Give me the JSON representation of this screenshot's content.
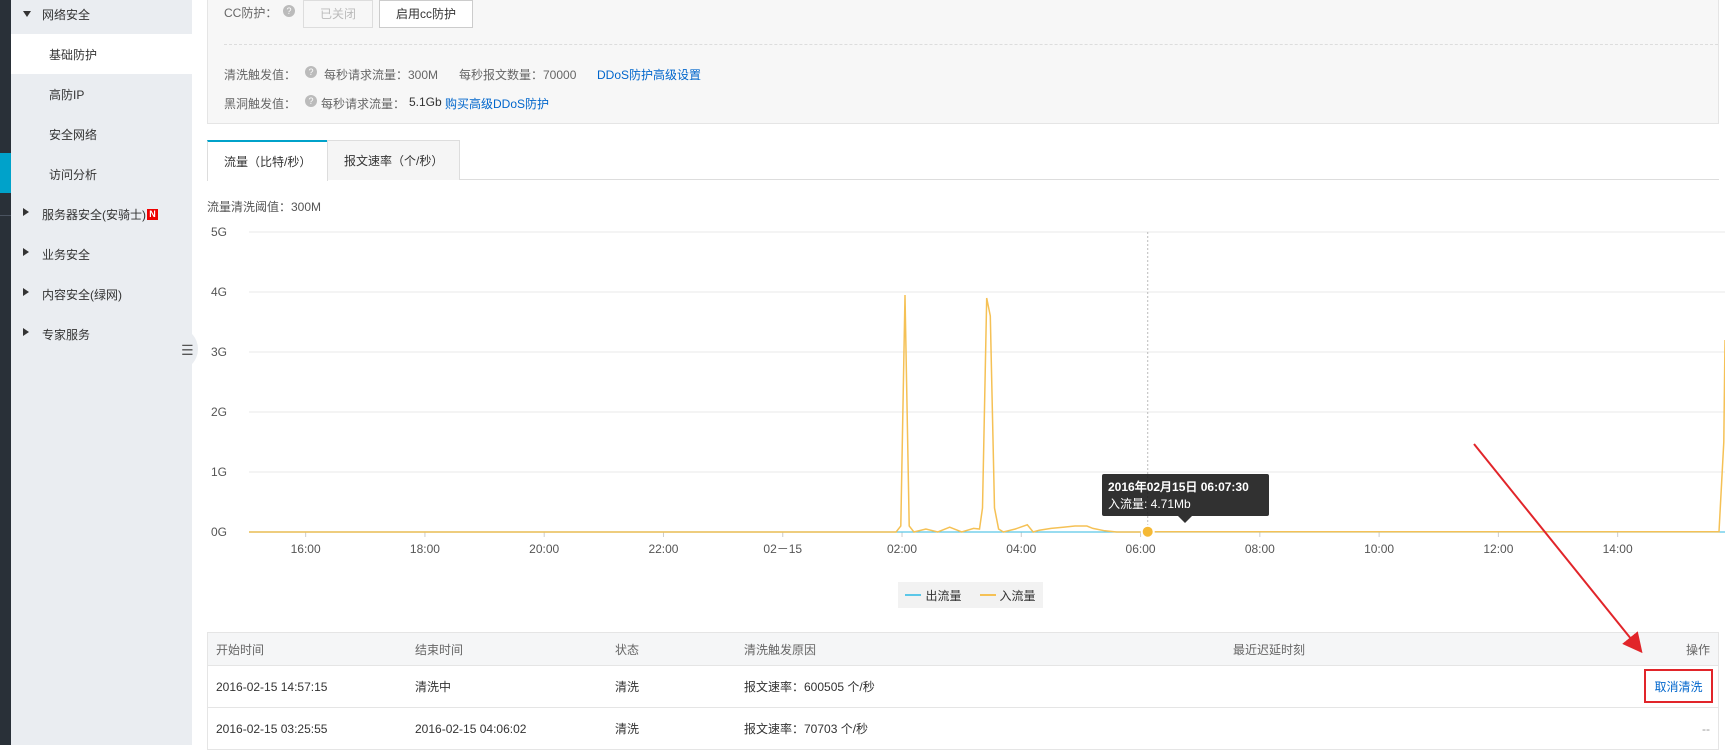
{
  "sidebar": {
    "groups": [
      {
        "label": "网络安全",
        "expanded": true
      },
      {
        "label": "服务器安全(安骑士)",
        "badge": "N"
      },
      {
        "label": "业务安全"
      },
      {
        "label": "内容安全(绿网)"
      },
      {
        "label": "专家服务"
      }
    ],
    "items": [
      {
        "label": "基础防护",
        "active": true
      },
      {
        "label": "高防IP"
      },
      {
        "label": "安全网络"
      },
      {
        "label": "访问分析"
      }
    ],
    "collapse_icon": "list-icon"
  },
  "settings": {
    "cc_label": "CC防护：",
    "cc_off_button": "已关闭",
    "cc_enable_button": "启用cc防护",
    "clean_label": "清洗触发值：",
    "clean_req_label": "每秒请求流量：300M",
    "clean_pkt_label": "每秒报文数量：70000",
    "clean_link": "DDoS防护高级设置",
    "black_label": "黑洞触发值：",
    "black_req_label": "每秒请求流量：",
    "black_req_value": "5.1Gb",
    "black_link": "购买高级DDoS防护"
  },
  "tabs": [
    {
      "label": "流量（比特/秒）",
      "active": true
    },
    {
      "label": "报文速率（个/秒）"
    }
  ],
  "threshold_text": "流量清洗阈值：300M",
  "tooltip": {
    "time": "2016年02月15日 06:07:30",
    "value": "入流量: 4.71Mb"
  },
  "chart_data": {
    "type": "line",
    "y_ticks": [
      "0G",
      "1G",
      "2G",
      "3G",
      "4G",
      "5G"
    ],
    "ylim": [
      0,
      5
    ],
    "x_ticks": [
      "16:00",
      "18:00",
      "20:00",
      "22:00",
      "02－15",
      "02:00",
      "04:00",
      "06:00",
      "08:00",
      "10:00",
      "12:00",
      "14:00"
    ],
    "x_tick_hours": [
      0,
      2,
      4,
      6,
      8,
      10,
      12,
      14,
      16,
      18,
      20,
      22
    ],
    "xlim_hours": [
      -0.95,
      23.8
    ],
    "grid": true,
    "legend_placement": "bottom-center",
    "series": [
      {
        "name": "出流量",
        "color": "#5bc7e8",
        "x": [
          -0.95,
          23.8
        ],
        "y": [
          0,
          0
        ]
      },
      {
        "name": "入流量",
        "color": "#f5c155",
        "x": [
          -0.95,
          9.9,
          9.98,
          10.05,
          10.12,
          10.2,
          10.4,
          10.6,
          10.8,
          11.0,
          11.2,
          11.3,
          11.35,
          11.42,
          11.48,
          11.55,
          11.62,
          11.7,
          11.9,
          12.1,
          12.2,
          12.3,
          12.5,
          12.7,
          12.9,
          13.1,
          13.2,
          13.4,
          13.6,
          14.0,
          14.12,
          23.7,
          23.78,
          23.8
        ],
        "y": [
          0,
          0,
          0.1,
          3.95,
          0.1,
          0,
          0.05,
          0,
          0.08,
          0,
          0.06,
          0.05,
          0.4,
          3.9,
          3.6,
          0.4,
          0.05,
          0,
          0.05,
          0.12,
          0,
          0.03,
          0.06,
          0.08,
          0.1,
          0.1,
          0.06,
          0.02,
          0,
          0,
          0.005,
          0.005,
          1.5,
          3.2
        ]
      }
    ],
    "highlight": {
      "x": 14.12,
      "y": 0.005
    }
  },
  "legend": [
    {
      "label": "出流量",
      "color": "#5bc7e8"
    },
    {
      "label": "入流量",
      "color": "#f5c155"
    }
  ],
  "table": {
    "headers": [
      "开始时间",
      "结束时间",
      "状态",
      "清洗触发原因",
      "最近迟延时刻",
      "操作"
    ],
    "rows": [
      {
        "start": "2016-02-15 14:57:15",
        "end": "清洗中",
        "status": "清洗",
        "reason": "报文速率：600505 个/秒",
        "action": "取消清洗"
      },
      {
        "start": "2016-02-15 03:25:55",
        "end": "2016-02-15 04:06:02",
        "status": "清洗",
        "reason": "报文速率：70703 个/秒",
        "action": "--"
      }
    ]
  },
  "colors": {
    "accent": "#00a2ca",
    "link": "#0066cc",
    "highlight_box": "#e1252a",
    "annotation_arrow": "#e1252a"
  }
}
